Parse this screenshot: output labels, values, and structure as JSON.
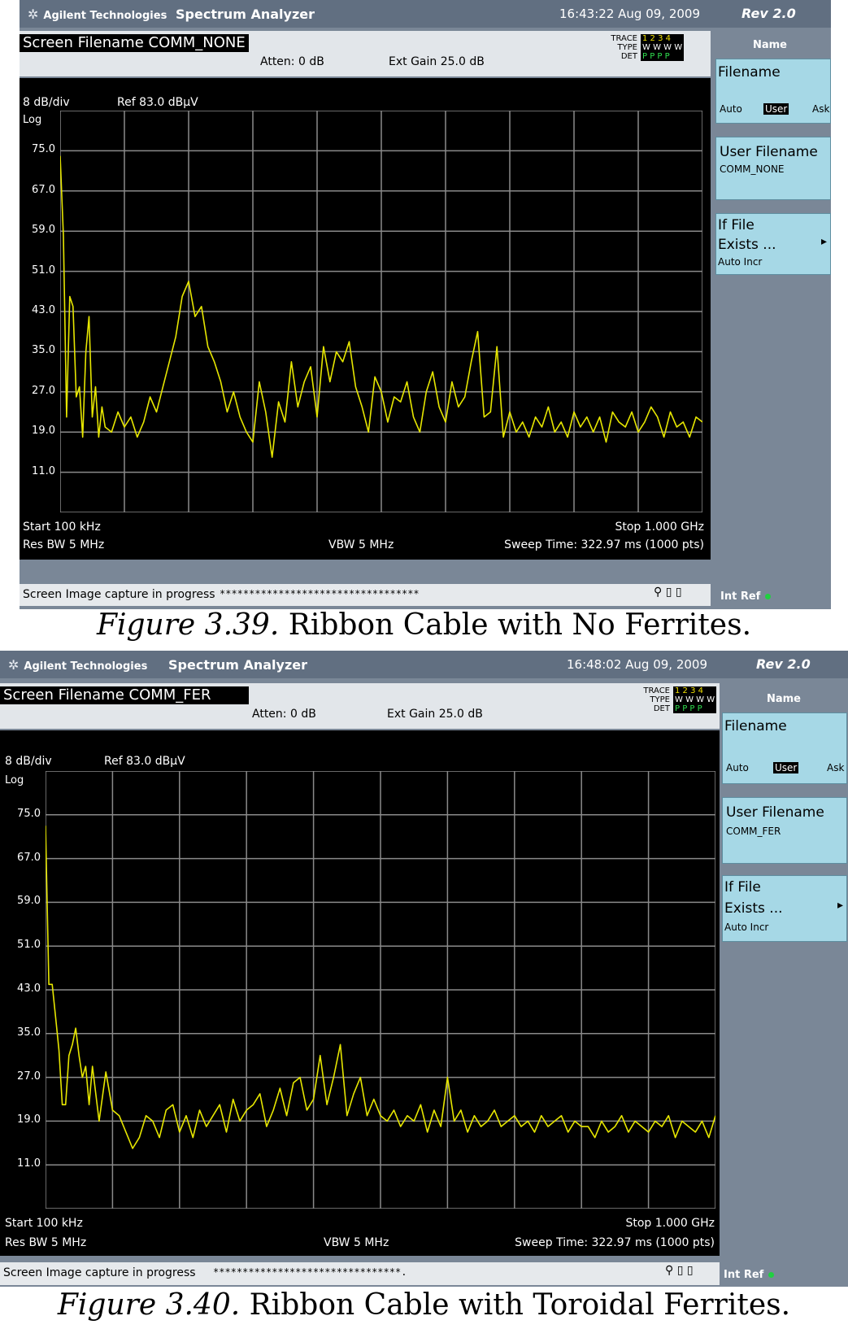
{
  "figures": [
    {
      "brand": "Agilent Technologies",
      "app": "Spectrum Analyzer",
      "time": "16:43:22  Aug 09, 2009",
      "rev": "Rev 2.0",
      "screen_filename": "Screen Filename COMM_NONE",
      "atten": "Atten: 0 dB",
      "ext_gain": "Ext Gain 25.0 dB",
      "trace_labels": [
        "TRACE",
        "TYPE",
        "DET"
      ],
      "trace_row1": "1 2 3 4",
      "trace_row2": "W W W W",
      "trace_row3": "P P P P",
      "scale_div": "8 dB/div",
      "ref_level": "Ref 83.0 dBµV",
      "scale_type": "Log",
      "start": "Start 100 kHz",
      "stop": "Stop 1.000 GHz",
      "res_bw": "Res BW 5 MHz",
      "vbw": "VBW 5 MHz",
      "sweep": "Sweep Time: 322.97 ms (1000 pts)",
      "status": "Screen Image capture in progress",
      "status_stars": "**********************************",
      "status_icons": "⚲ ▯ ▯",
      "int_ref": "Int Ref",
      "softkeys": {
        "title": "Name",
        "filename": "Filename",
        "opt_auto": "Auto",
        "opt_user": "User",
        "opt_ask": "Ask",
        "user_filename": "User Filename",
        "user_filename_value": "COMM_NONE",
        "if_file_line1": "If File",
        "if_file_line2": "Exists ...",
        "if_file_value": "Auto Incr",
        "arrow": "▸"
      },
      "caption_label": "Figure 3.39.",
      "caption_text": " Ribbon Cable with No Ferrites."
    },
    {
      "brand": "Agilent Technologies",
      "app": "Spectrum Analyzer",
      "time": "16:48:02  Aug 09, 2009",
      "rev": "Rev 2.0",
      "screen_filename": "Screen Filename COMM_FER",
      "atten": "Atten: 0 dB",
      "ext_gain": "Ext Gain 25.0 dB",
      "trace_labels": [
        "TRACE",
        "TYPE",
        "DET"
      ],
      "trace_row1": "1 2 3 4",
      "trace_row2": "W W W W",
      "trace_row3": "P P P P",
      "scale_div": "8 dB/div",
      "ref_level": "Ref 83.0 dBµV",
      "scale_type": "Log",
      "start": "Start 100 kHz",
      "stop": "Stop 1.000 GHz",
      "res_bw": "Res BW 5 MHz",
      "vbw": "VBW 5 MHz",
      "sweep": "Sweep Time: 322.97 ms (1000 pts)",
      "status": "Screen Image capture in progress",
      "status_stars": "********************************.",
      "status_icons": "⚲ ▯ ▯",
      "int_ref": "Int Ref",
      "softkeys": {
        "title": "Name",
        "filename": "Filename",
        "opt_auto": "Auto",
        "opt_user": "User",
        "opt_ask": "Ask",
        "user_filename": "User Filename",
        "user_filename_value": "COMM_FER",
        "if_file_line1": "If File",
        "if_file_line2": "Exists ...",
        "if_file_value": "Auto Incr",
        "arrow": "▸"
      },
      "caption_label": "Figure 3.40.",
      "caption_text": " Ribbon Cable with Toroidal Ferrites."
    }
  ],
  "colors": {
    "trace": "#e6e600",
    "grid": "#8a8a8a",
    "screen": "#000000",
    "softkey": "#a6d8e6"
  },
  "chart_data": [
    {
      "type": "line",
      "title": "",
      "xlabel": "",
      "ylabel": "",
      "ref_level_dbuv": 83.0,
      "db_per_div": 8,
      "y_tick_labels": [
        "75.0",
        "67.0",
        "59.0",
        "51.0",
        "43.0",
        "35.0",
        "27.0",
        "19.0",
        "11.0"
      ],
      "ylim": [
        3.0,
        83.0
      ],
      "xlim_mhz": [
        0.1,
        1000
      ],
      "grid": true,
      "series": [
        {
          "x_mhz": [
            0,
            5,
            10,
            15,
            20,
            25,
            30,
            35,
            40,
            45,
            50,
            55,
            60,
            65,
            70,
            80,
            90,
            100,
            110,
            120,
            130,
            140,
            150,
            160,
            170,
            180,
            190,
            200,
            210,
            220,
            230,
            240,
            250,
            260,
            270,
            280,
            290,
            300,
            310,
            320,
            330,
            340,
            350,
            360,
            370,
            380,
            390,
            400,
            410,
            420,
            430,
            440,
            450,
            460,
            470,
            480,
            490,
            500,
            510,
            520,
            530,
            540,
            550,
            560,
            570,
            580,
            590,
            600,
            610,
            620,
            630,
            640,
            650,
            660,
            670,
            680,
            690,
            700,
            710,
            720,
            730,
            740,
            750,
            760,
            770,
            780,
            790,
            800,
            810,
            820,
            830,
            840,
            850,
            860,
            870,
            880,
            890,
            900,
            910,
            920,
            930,
            940,
            950,
            960,
            970,
            980,
            990,
            1000
          ],
          "values_dbuv": [
            74,
            58,
            22,
            46,
            44,
            26,
            28,
            18,
            35,
            42,
            22,
            28,
            18,
            24,
            20,
            19,
            23,
            20,
            22,
            18,
            21,
            26,
            23,
            28,
            33,
            38,
            46,
            49,
            42,
            44,
            36,
            33,
            29,
            23,
            27,
            22,
            19,
            17,
            29,
            23,
            14,
            25,
            21,
            33,
            24,
            29,
            32,
            22,
            36,
            29,
            35,
            33,
            37,
            28,
            24,
            19,
            30,
            27,
            21,
            26,
            25,
            29,
            22,
            19,
            27,
            31,
            24,
            21,
            29,
            24,
            26,
            33,
            39,
            22,
            23,
            36,
            18,
            23,
            19,
            21,
            18,
            22,
            20,
            24,
            19,
            21,
            18,
            23,
            20,
            22,
            19,
            22,
            17,
            23,
            21,
            20,
            23,
            19,
            21,
            24,
            22,
            18,
            23,
            20,
            21,
            18,
            22,
            21
          ]
        }
      ]
    },
    {
      "type": "line",
      "title": "",
      "xlabel": "",
      "ylabel": "",
      "ref_level_dbuv": 83.0,
      "db_per_div": 8,
      "y_tick_labels": [
        "75.0",
        "67.0",
        "59.0",
        "51.0",
        "43.0",
        "35.0",
        "27.0",
        "19.0",
        "11.0"
      ],
      "ylim": [
        3.0,
        83.0
      ],
      "xlim_mhz": [
        0.1,
        1000
      ],
      "grid": true,
      "series": [
        {
          "x_mhz": [
            0,
            5,
            10,
            15,
            20,
            25,
            30,
            35,
            40,
            45,
            50,
            55,
            60,
            65,
            70,
            80,
            90,
            100,
            110,
            120,
            130,
            140,
            150,
            160,
            170,
            180,
            190,
            200,
            210,
            220,
            230,
            240,
            250,
            260,
            270,
            280,
            290,
            300,
            310,
            320,
            330,
            340,
            350,
            360,
            370,
            380,
            390,
            400,
            410,
            420,
            430,
            440,
            450,
            460,
            470,
            480,
            490,
            500,
            510,
            520,
            530,
            540,
            550,
            560,
            570,
            580,
            590,
            600,
            610,
            620,
            630,
            640,
            650,
            660,
            670,
            680,
            690,
            700,
            710,
            720,
            730,
            740,
            750,
            760,
            770,
            780,
            790,
            800,
            810,
            820,
            830,
            840,
            850,
            860,
            870,
            880,
            890,
            900,
            910,
            920,
            930,
            940,
            950,
            960,
            970,
            980,
            990,
            1000
          ],
          "values_dbuv": [
            73,
            44,
            44,
            38,
            32,
            22,
            22,
            31,
            33,
            36,
            31,
            27,
            29,
            22,
            29,
            19,
            28,
            21,
            20,
            17,
            14,
            16,
            20,
            19,
            16,
            21,
            22,
            17,
            20,
            16,
            21,
            18,
            20,
            22,
            17,
            23,
            19,
            21,
            22,
            24,
            18,
            21,
            25,
            20,
            26,
            27,
            21,
            23,
            31,
            22,
            27,
            33,
            20,
            24,
            27,
            20,
            23,
            20,
            19,
            21,
            18,
            20,
            19,
            22,
            17,
            21,
            18,
            27,
            19,
            21,
            17,
            20,
            18,
            19,
            21,
            18,
            19,
            20,
            18,
            19,
            17,
            20,
            18,
            19,
            20,
            17,
            19,
            18,
            18,
            16,
            19,
            17,
            18,
            20,
            17,
            19,
            18,
            17,
            19,
            18,
            20,
            16,
            19,
            18,
            17,
            19,
            16,
            20
          ]
        }
      ]
    }
  ]
}
